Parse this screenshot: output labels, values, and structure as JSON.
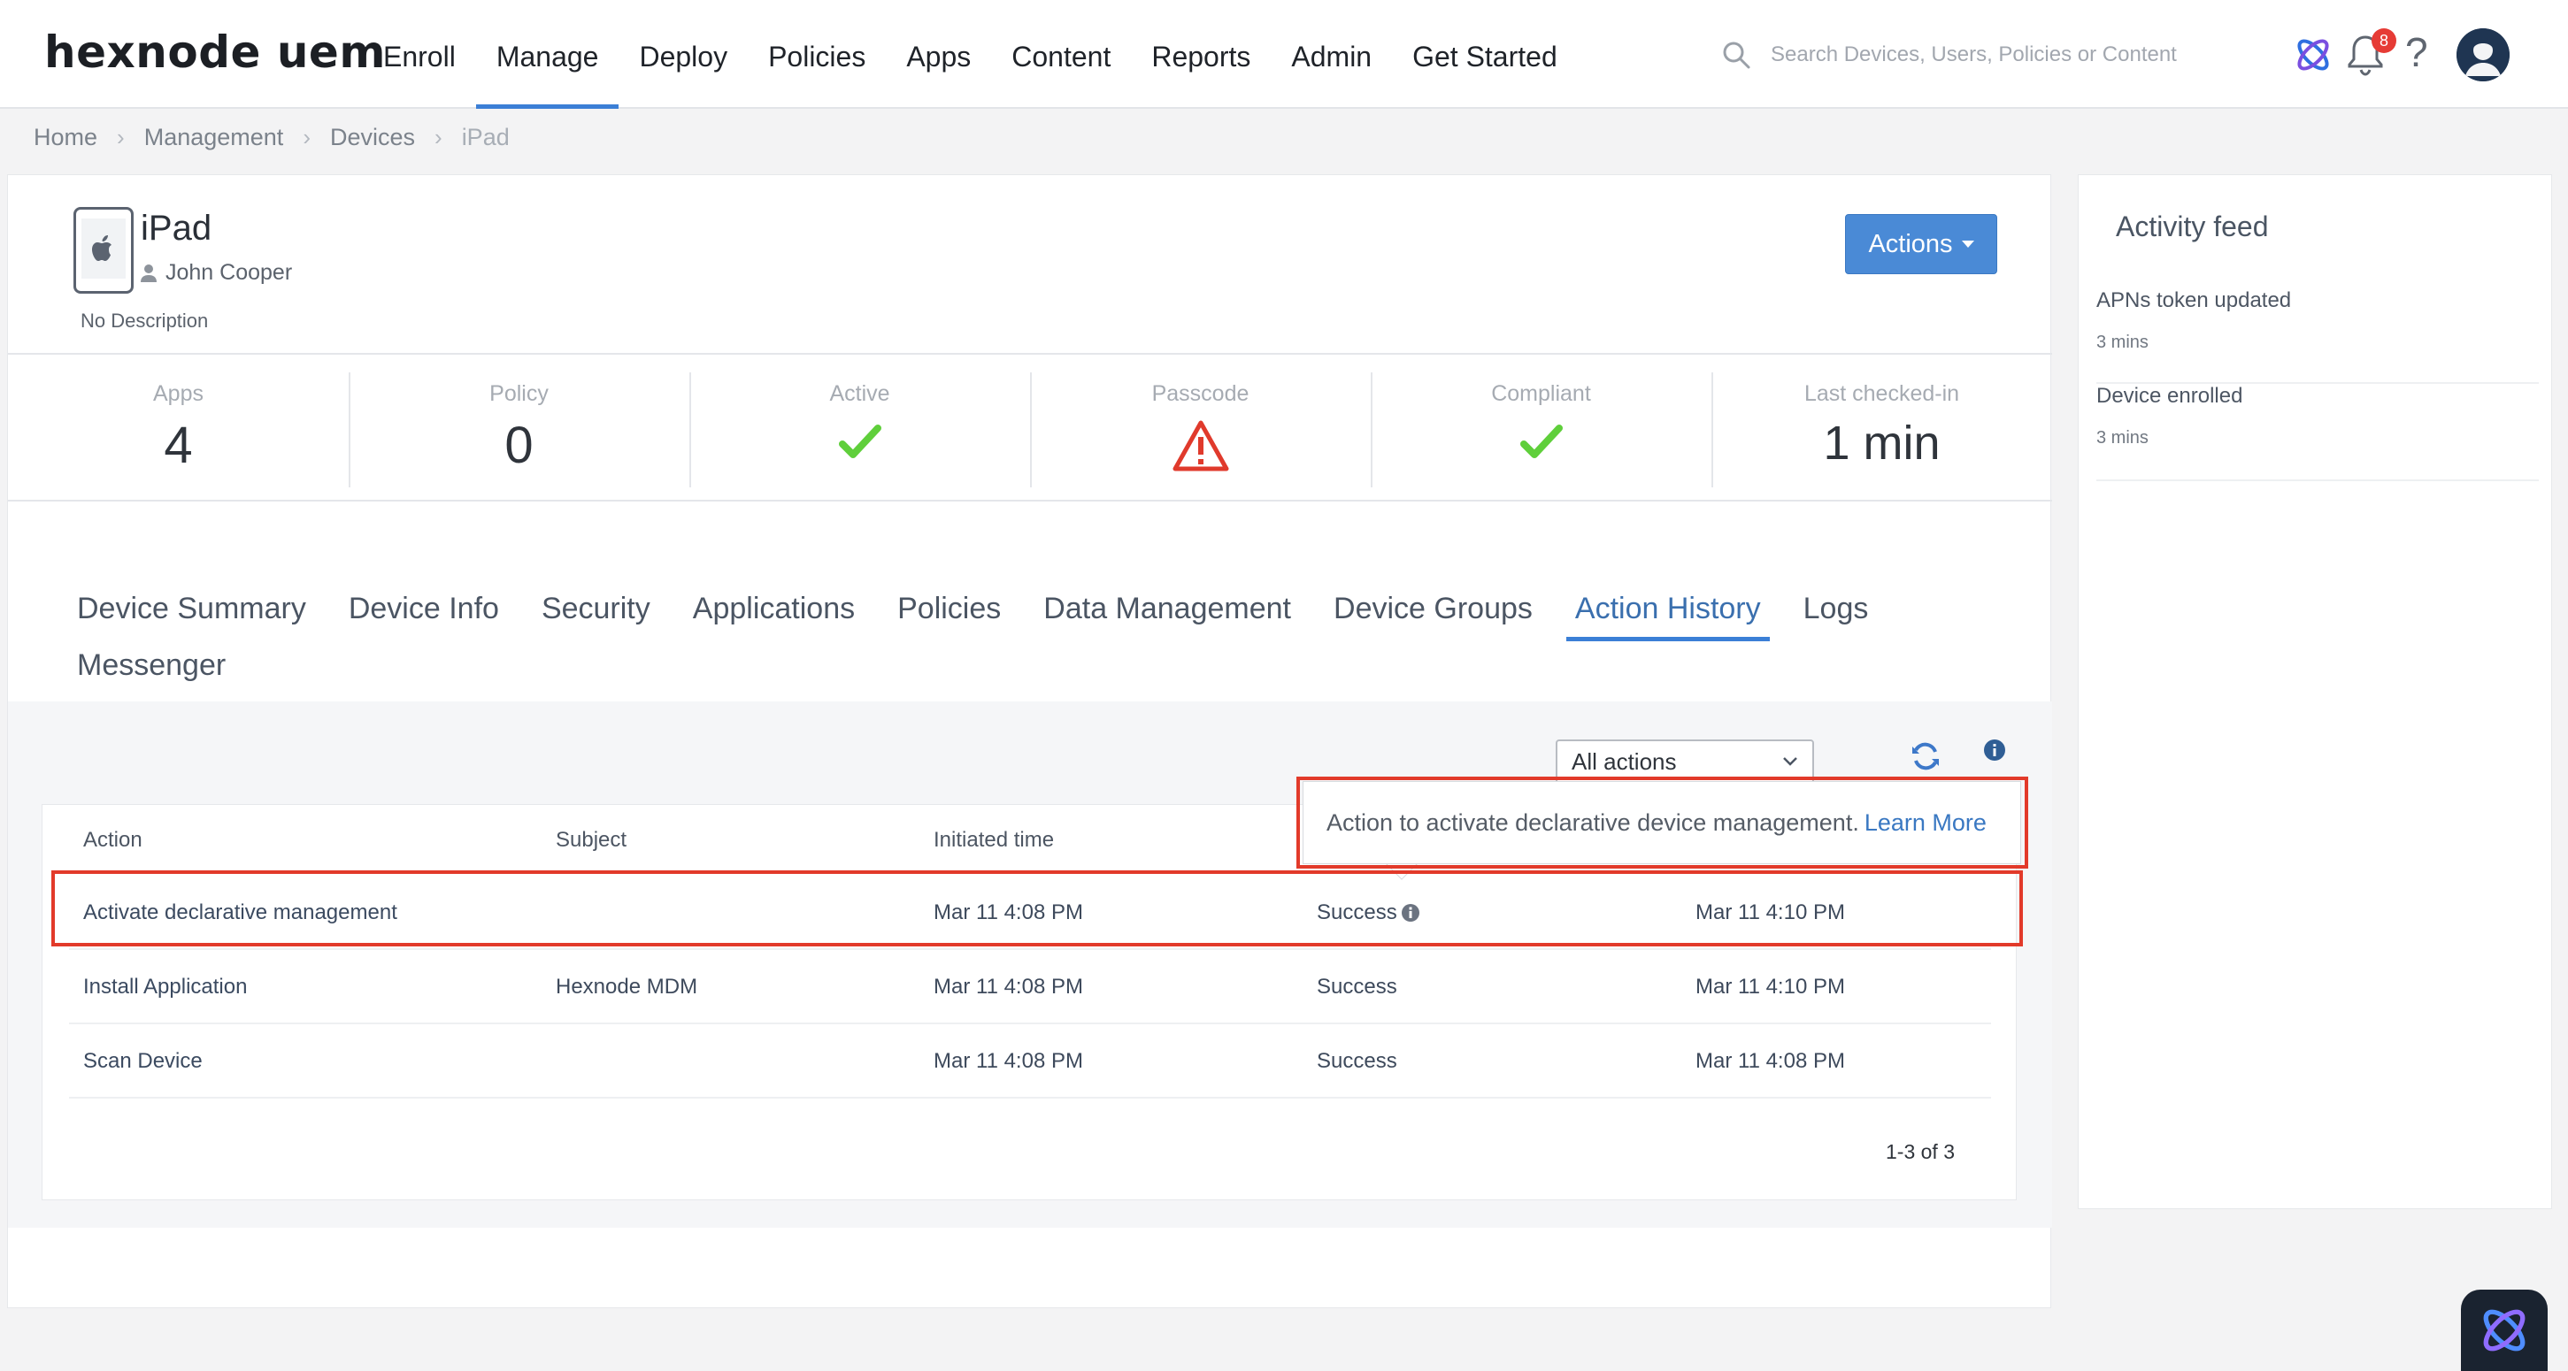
{
  "header": {
    "logo": "hexnode uem",
    "nav": [
      {
        "label": "Enroll"
      },
      {
        "label": "Manage",
        "active": true
      },
      {
        "label": "Deploy"
      },
      {
        "label": "Policies"
      },
      {
        "label": "Apps"
      },
      {
        "label": "Content"
      },
      {
        "label": "Reports"
      },
      {
        "label": "Admin"
      },
      {
        "label": "Get Started"
      }
    ],
    "search_placeholder": "Search Devices, Users, Policies or Content",
    "notification_count": "8",
    "help_glyph": "?",
    "accent_color": "#3b7fd6"
  },
  "breadcrumb": [
    "Home",
    "Management",
    "Devices",
    "iPad"
  ],
  "device": {
    "name": "iPad",
    "user": "John Cooper",
    "description": "No Description",
    "actions_label": "Actions"
  },
  "stats": [
    {
      "label": "Apps",
      "value": "4"
    },
    {
      "label": "Policy",
      "value": "0"
    },
    {
      "label": "Active",
      "icon": "check-icon"
    },
    {
      "label": "Passcode",
      "icon": "warning-icon"
    },
    {
      "label": "Compliant",
      "icon": "check-icon"
    },
    {
      "label": "Last checked-in",
      "value": "1 min"
    }
  ],
  "tabs": [
    "Device Summary",
    "Device Info",
    "Security",
    "Applications",
    "Policies",
    "Data Management",
    "Device Groups",
    "Action History",
    "Logs",
    "Messenger"
  ],
  "active_tab": "Action History",
  "action_history": {
    "filter": "All actions",
    "columns": [
      "Action",
      "Subject",
      "Initiated time"
    ],
    "rows": [
      {
        "action": "Activate declarative management",
        "subject": "",
        "initiated": "Mar 11 4:08 PM",
        "status": "Success",
        "completed": "Mar 11 4:10 PM"
      },
      {
        "action": "Install Application",
        "subject": "Hexnode MDM",
        "initiated": "Mar 11 4:08 PM",
        "status": "Success",
        "completed": "Mar 11 4:10 PM"
      },
      {
        "action": "Scan Device",
        "subject": "",
        "initiated": "Mar 11 4:08 PM",
        "status": "Success",
        "completed": "Mar 11 4:08 PM"
      }
    ],
    "pagination": "1-3 of 3",
    "tooltip": {
      "text": "Action to activate declarative device management.",
      "link": "Learn More"
    }
  },
  "activity_feed": {
    "title": "Activity feed",
    "items": [
      {
        "text": "APNs token updated",
        "time": "3 mins"
      },
      {
        "text": "Device enrolled",
        "time": "3 mins"
      }
    ]
  },
  "colors": {
    "success_green": "#5fcf3b",
    "warning_red": "#e03a2c",
    "highlight_red": "#e23a2a"
  }
}
